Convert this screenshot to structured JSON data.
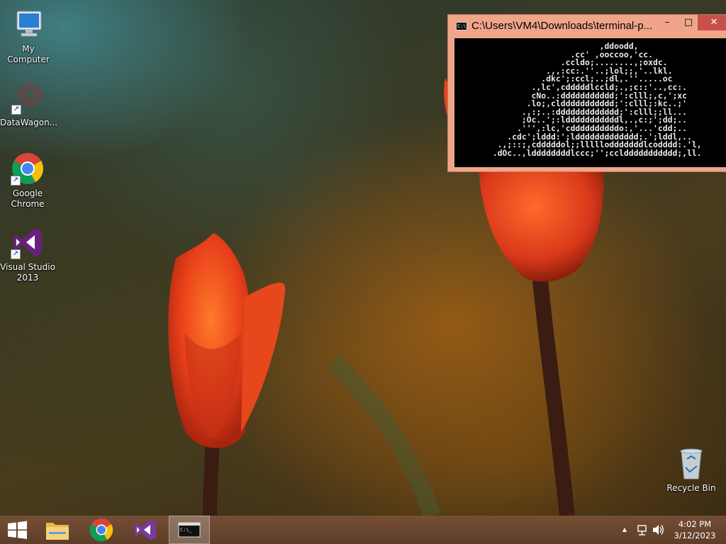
{
  "desktop": {
    "icons": [
      {
        "label": "My Computer",
        "icon": "computer-icon"
      },
      {
        "label": "DataWagon...",
        "icon": "datawagon-icon"
      },
      {
        "label": "Google Chrome",
        "icon": "chrome-icon"
      },
      {
        "label": "Visual Studio 2013",
        "icon": "visual-studio-icon"
      },
      {
        "label": "Recycle Bin",
        "icon": "recycle-bin-icon"
      }
    ]
  },
  "console": {
    "title": "C:\\Users\\VM4\\Downloads\\terminal-p...",
    "buttons": {
      "minimize": "–",
      "maximize": "□",
      "close": "✕"
    },
    "output": "                        ,ddoodd,\n                  .cc' ,ooccoo,'cc.\n                .ccldo;........,;oxdc.\n             .,,:cc:.''..;lol;;,'..lkl.\n            .dkc';:ccl;..;dl,.''.....oc\n          .,lc',cdddddlccld;.,;c::'..,cc:.\n          cNo..:ddddddddddd;':clll;,c,';xc\n         .lo;,clddddddddddd;':clll;:kc..;'\n        .,:;..:ddddddddddddd;':clll;;ll...\n        ;Oc..';:ldddddddddddl,.,c:;';dd;..\n       .''',:lc,'cddddddddddo:,'...'cdd;..\n     .cdc';lddd:';lddddddddddddd;.';lddl,..\n   .,;::;,cdddddol;;lllllodddddddlcodddd:.'l,\n  .dOc..,lddddddddlccc;'';cclddddddddddd;,ll."
  },
  "taskbar": {
    "start_icon": "windows-logo-icon",
    "pinned": [
      {
        "name": "file-explorer",
        "icon": "folder-icon"
      },
      {
        "name": "chrome",
        "icon": "chrome-icon"
      },
      {
        "name": "visual-studio",
        "icon": "visual-studio-icon"
      },
      {
        "name": "command-prompt",
        "icon": "console-icon",
        "active": true
      }
    ],
    "tray": {
      "chevron": "▲",
      "network_icon": "network-icon",
      "volume_icon": "volume-icon"
    },
    "clock": {
      "time": "4:02 PM",
      "date": "3/12/2023"
    }
  },
  "colors": {
    "console_frame": "#f0a58a",
    "close_button": "#c7504b",
    "taskbar": "#6e4a33"
  }
}
